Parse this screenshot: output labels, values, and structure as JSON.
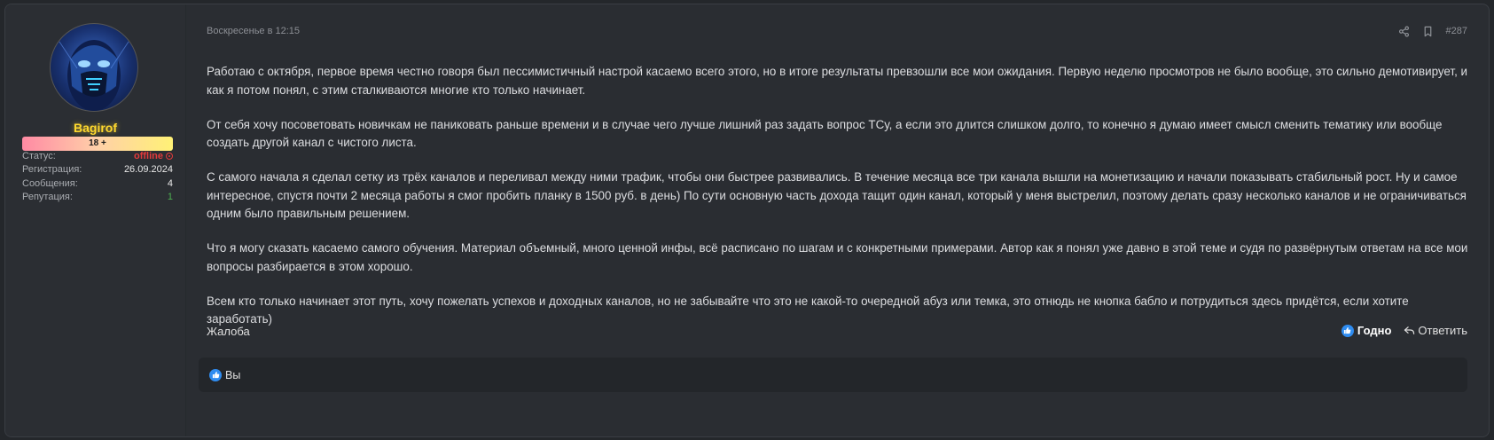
{
  "author": {
    "username": "Bagirof",
    "badge": "18 +",
    "stats": [
      {
        "label": "Статус:",
        "value": "offline",
        "status": "offline"
      },
      {
        "label": "Регистрация:",
        "value": "26.09.2024"
      },
      {
        "label": "Сообщения:",
        "value": "4"
      },
      {
        "label": "Репутация:",
        "value": "1"
      }
    ]
  },
  "post": {
    "date": "Воскресенье в 12:15",
    "number": "#287",
    "icons": [
      "share-icon",
      "bookmark-icon"
    ],
    "paragraphs": [
      "Работаю с октября, первое время честно говоря был пессимистичный настрой касаемо всего этого, но в итоге результаты превзошли все мои ожидания. Первую неделю просмотров не было вообще, это сильно демотивирует, и как я потом понял, с этим сталкиваются многие кто только начинает.",
      "От себя хочу посоветовать новичкам не паниковать раньше времени и в случае чего лучше лишний раз задать вопрос ТСу, а если это длится слишком долго, то конечно я думаю имеет смысл сменить тематику или вообще создать другой канал с чистого листа.",
      "С самого начала я сделал сетку из трёх каналов и переливал между ними трафик, чтобы они быстрее развивались. В течение месяца все три канала вышли на монетизацию и начали показывать стабильный рост. Ну и самое интересное, спустя почти 2 месяца работы я смог пробить планку в 1500 руб. в день) По сути основную часть дохода тащит один канал, который у меня выстрелил, поэтому делать сразу несколько каналов и не ограничиваться одним было правильным решением.",
      "Что я могу сказать касаемо самого обучения. Материал объемный, много ценной инфы, всё расписано по шагам и с конкретными примерами. Автор как я понял уже давно в этой теме и судя по развёрнутым ответам на все мои вопросы разбирается в этом хорошо.",
      "Всем кто только начинает этот путь, хочу пожелать успехов и доходных каналов, но не забывайте что это не какой-то очередной абуз или темка, это отнюдь не кнопка бабло и потрудиться здесь придётся, если хотите заработать)"
    ],
    "report_label": "Жалоба",
    "like_label": "Годно",
    "reply_label": "Ответить",
    "reactions_text": "Вы"
  },
  "colors": {
    "accent": "#2f8cf0",
    "username": "#ffd92e",
    "offline": "#e33b3b",
    "reputation": "#4caf50"
  }
}
